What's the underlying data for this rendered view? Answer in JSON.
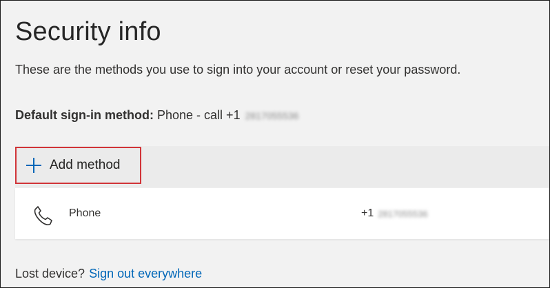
{
  "page": {
    "title": "Security info",
    "subtitle": "These are the methods you use to sign into your account or reset your password."
  },
  "default_method": {
    "label": "Default sign-in method:",
    "value": "Phone - call +1",
    "number_redacted": "2817055536"
  },
  "add_method": {
    "label": "Add method",
    "icon": "plus-icon"
  },
  "methods": [
    {
      "icon": "phone-icon",
      "name": "Phone",
      "value_prefix": "+1",
      "value_redacted": "2817055536"
    }
  ],
  "footer": {
    "prefix": "Lost device?",
    "link": "Sign out everywhere"
  },
  "colors": {
    "accent": "#0067b8",
    "highlight_border": "#d13438"
  }
}
